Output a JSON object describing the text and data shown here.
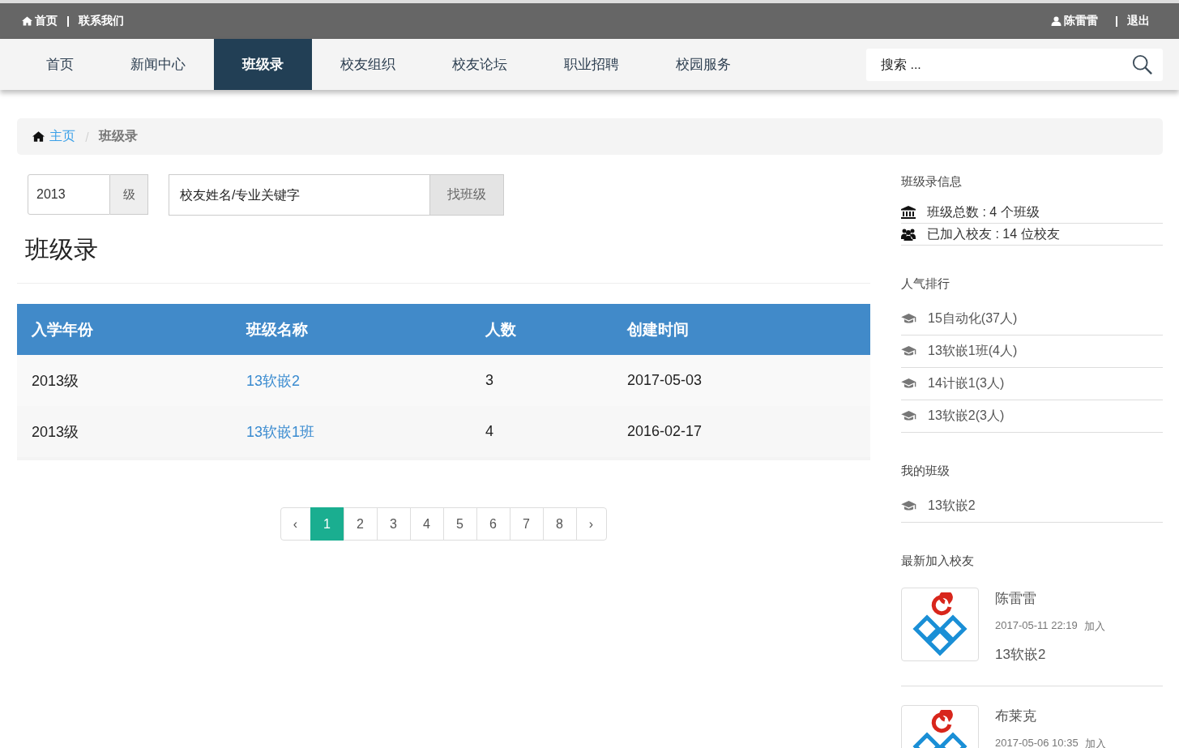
{
  "topbar": {
    "links": [
      "首页",
      "联系我们"
    ],
    "user": "陈雷雷",
    "logout": "退出"
  },
  "nav": {
    "items": [
      {
        "label": "首页",
        "selected": false
      },
      {
        "label": "新闻中心",
        "selected": false
      },
      {
        "label": "班级录",
        "selected": true
      },
      {
        "label": "校友组织",
        "selected": false
      },
      {
        "label": "校友论坛",
        "selected": false
      },
      {
        "label": "职业招聘",
        "selected": false
      },
      {
        "label": "校园服务",
        "selected": false
      }
    ],
    "search_placeholder": "搜索 ..."
  },
  "breadcrumb": {
    "home": "主页",
    "current": "班级录"
  },
  "filter": {
    "year": "2013",
    "year_suffix": "级",
    "keyword_placeholder": "校友姓名/专业关键字",
    "button": "找班级"
  },
  "heading": "班级录",
  "table": {
    "columns": [
      "入学年份",
      "班级名称",
      "人数",
      "创建时间"
    ],
    "rows": [
      [
        "2013级",
        "13软嵌2",
        "3",
        "2017-05-03"
      ],
      [
        "2013级",
        "13软嵌1班",
        "4",
        "2016-02-17"
      ]
    ]
  },
  "pagination": {
    "prev": "‹",
    "next": "›",
    "pages": [
      {
        "label": "1",
        "selected": true
      },
      {
        "label": "2",
        "selected": false
      },
      {
        "label": "3",
        "selected": false
      },
      {
        "label": "4",
        "selected": false
      },
      {
        "label": "5",
        "selected": false
      },
      {
        "label": "6",
        "selected": false
      },
      {
        "label": "7",
        "selected": false
      },
      {
        "label": "8",
        "selected": false
      }
    ]
  },
  "sidebar": {
    "info_title": "班级录信息",
    "info": [
      {
        "kind": "classes",
        "text": "班级总数 : 4 个班级"
      },
      {
        "kind": "alumni",
        "text": "已加入校友 : 14 位校友"
      }
    ],
    "ranking_title": "人气排行",
    "ranking": [
      "15自动化(37人)",
      "13软嵌1班(4人)",
      "14计嵌1(3人)",
      "13软嵌2(3人)"
    ],
    "my_title": "我的班级",
    "my_classes": [
      "13软嵌2"
    ],
    "newest_title": "最新加入校友",
    "newest": [
      {
        "name": "陈雷雷",
        "time": "2017-05-11 22:19",
        "joined": "加入",
        "class": "13软嵌2"
      },
      {
        "name": "布莱克",
        "time": "2017-05-06 10:35",
        "joined": "加入"
      }
    ]
  }
}
